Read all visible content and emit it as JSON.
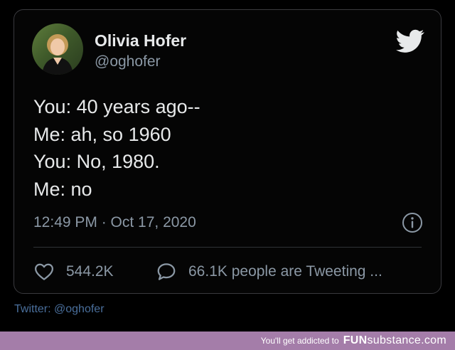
{
  "tweet": {
    "author_name": "Olivia Hofer",
    "author_handle": "@oghofer",
    "lines": [
      "You: 40 years ago--",
      "Me: ah, so 1960",
      "You: No, 1980.",
      "Me: no"
    ],
    "timestamp": "12:49 PM · Oct 17, 2020",
    "likes": "544.2K",
    "tweeting": "66.1K people are Tweeting ..."
  },
  "source_label": "Twitter: @oghofer",
  "footer": {
    "tagline": "You'll get addicted to",
    "brand_part1": "FUN",
    "brand_part2": "substance.com"
  },
  "colors": {
    "background": "#000000",
    "text_primary": "#e7e9ea",
    "text_secondary": "#8b98a5",
    "link": "#4a6f9c",
    "footer_bg": "#a47da9"
  },
  "icons": {
    "logo": "twitter-bird-icon",
    "info": "info-icon",
    "like": "heart-icon",
    "reply": "speech-bubble-icon"
  }
}
